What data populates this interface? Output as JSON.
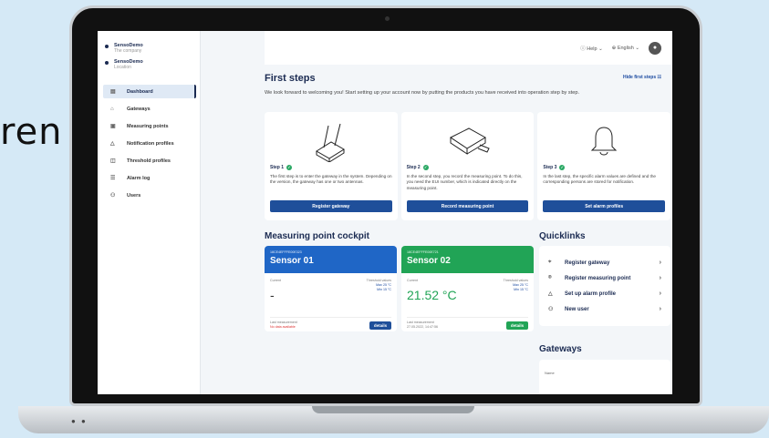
{
  "bg_text": "ren",
  "sidebar": {
    "orgs": [
      {
        "name": "SensoDemo",
        "sub": "The company"
      },
      {
        "name": "SensoDemo",
        "sub": "Location"
      }
    ],
    "items": [
      {
        "label": "Dashboard",
        "icon": "dashboard-icon",
        "active": true
      },
      {
        "label": "Gateways",
        "icon": "gateway-icon"
      },
      {
        "label": "Measuring points",
        "icon": "measuring-point-icon"
      },
      {
        "label": "Notification profiles",
        "icon": "bell-icon"
      },
      {
        "label": "Threshold profiles",
        "icon": "threshold-icon"
      },
      {
        "label": "Alarm log",
        "icon": "alarm-log-icon"
      },
      {
        "label": "Users",
        "icon": "users-icon"
      }
    ]
  },
  "topbar": {
    "help": "Help",
    "language": "English"
  },
  "first_steps": {
    "title": "First steps",
    "hide": "Hide first steps",
    "welcome": "We look forward to welcoming you! Start setting up your account now by putting the products you have received into operation step by step.",
    "steps": [
      {
        "label": "Step 1",
        "text": "The first step is to enter the gateway in the system. Depending on the version, the gateway has one or two antennas.",
        "button": "Register gateway"
      },
      {
        "label": "Step 2",
        "text": "In the second step, you record the measuring point. To do this, you need the EUI number, which is indicated directly on the measuring point.",
        "button": "Record measuring point"
      },
      {
        "label": "Step 3",
        "text": "In the last step, the specific alarm values are defined and the corresponding persons are stored for notification.",
        "button": "Set alarm profiles"
      }
    ]
  },
  "cockpit": {
    "title": "Measuring point cockpit",
    "sensors": [
      {
        "id": "18CE4EFFFE00E323",
        "name": "Sensor 01",
        "current_label": "Current",
        "value": "-",
        "threshold_label": "Threshold values",
        "max": "Max 25 °C",
        "min": "Min 15 °C",
        "last_label": "Last measurement",
        "last": "No data available",
        "button": "details",
        "color": "#1f66c6"
      },
      {
        "id": "18CE4EFFFE00E721",
        "name": "Sensor 02",
        "current_label": "Current",
        "value": "21.52 °C",
        "threshold_label": "Threshold values",
        "max": "Max 25 °C",
        "min": "Min 15 °C",
        "last_label": "Last measurement",
        "last": "27.05.2022, 14:47:56",
        "button": "details",
        "color": "#21a456"
      }
    ]
  },
  "quicklinks": {
    "title": "Quicklinks",
    "items": [
      {
        "label": "Register gateway",
        "icon": "antenna-icon"
      },
      {
        "label": "Register measuring point",
        "icon": "location-pin-icon"
      },
      {
        "label": "Set up alarm profile",
        "icon": "bell-icon"
      },
      {
        "label": "New user",
        "icon": "add-user-icon"
      }
    ]
  },
  "gateways": {
    "title": "Gateways",
    "col": "Name"
  }
}
